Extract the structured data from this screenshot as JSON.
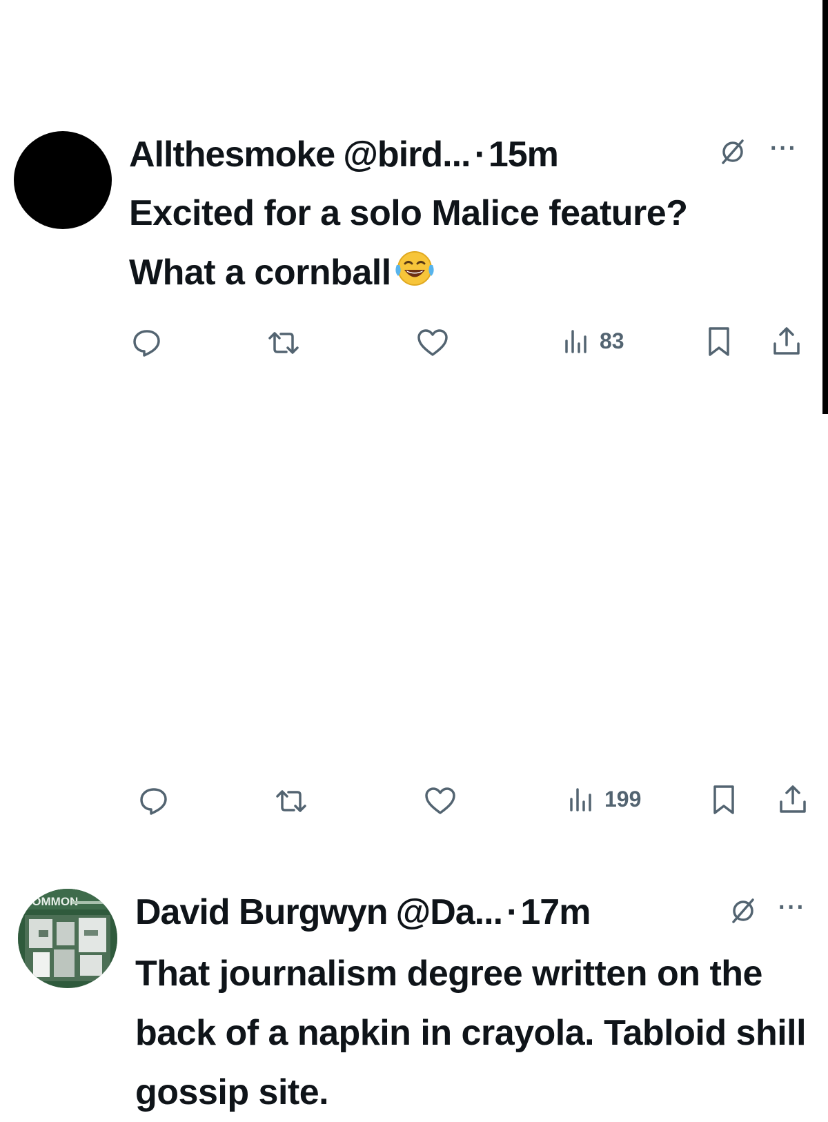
{
  "tweets": [
    {
      "name": "Allthesmoke",
      "handle": "@bird...",
      "separator": "·",
      "time": "15m",
      "text": "Excited for a solo Malice feature? What a cornball",
      "emoji": "face-with-tears-of-joy",
      "views": "83",
      "avatar": "black-circle"
    },
    {
      "name": "David Burgwyn",
      "handle": "@Da...",
      "separator": "·",
      "time": "17m",
      "text": "That journalism degree written on the back of a napkin in crayola. Tabloid shill gossip site.",
      "views": "199",
      "avatar": "green-vintage-photo",
      "avatar_text": "COMMON"
    }
  ],
  "icons": [
    "reply-icon",
    "repost-icon",
    "like-icon",
    "views-icon",
    "bookmark-icon",
    "share-icon",
    "grok-icon",
    "more-icon"
  ],
  "colors": {
    "text": "#0f1419",
    "muted": "#536471",
    "avatar_green": "#2f5a3c"
  }
}
